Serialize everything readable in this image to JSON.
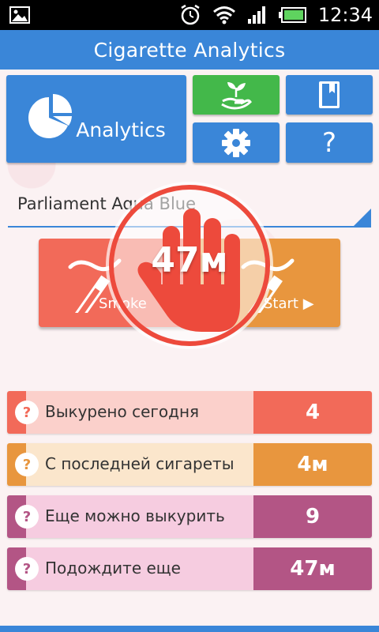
{
  "status_bar": {
    "time": "12:34"
  },
  "app": {
    "title": "Cigarette Analytics"
  },
  "tiles": {
    "analytics_label": "Analytics",
    "help_label": "?"
  },
  "brand": {
    "selected": "Parliament Aqua Blue"
  },
  "actions": {
    "smoke_label": "Smoke",
    "start_label": "Start ▶"
  },
  "timer": {
    "value": "47м"
  },
  "stats": [
    {
      "label": "Выкурено сегодня",
      "value": "4",
      "accent": "#f26a59",
      "label_bg": "#fbd0cb",
      "value_bg": "#f26a59"
    },
    {
      "label": "С последней сигареты",
      "value": "4м",
      "accent": "#e8963e",
      "label_bg": "#fbe6cc",
      "value_bg": "#e8963e"
    },
    {
      "label": "Еще можно выкурить",
      "value": "9",
      "accent": "#b35585",
      "label_bg": "#f6cce0",
      "value_bg": "#b35585"
    },
    {
      "label": "Подождите еще",
      "value": "47м",
      "accent": "#b35585",
      "label_bg": "#f6cce0",
      "value_bg": "#b35585"
    }
  ],
  "colors": {
    "primary": "#3a86d8",
    "green": "#43b84a",
    "smoke": "#f26a59",
    "start": "#e8963e",
    "timer_ring": "#ed4a3c"
  }
}
